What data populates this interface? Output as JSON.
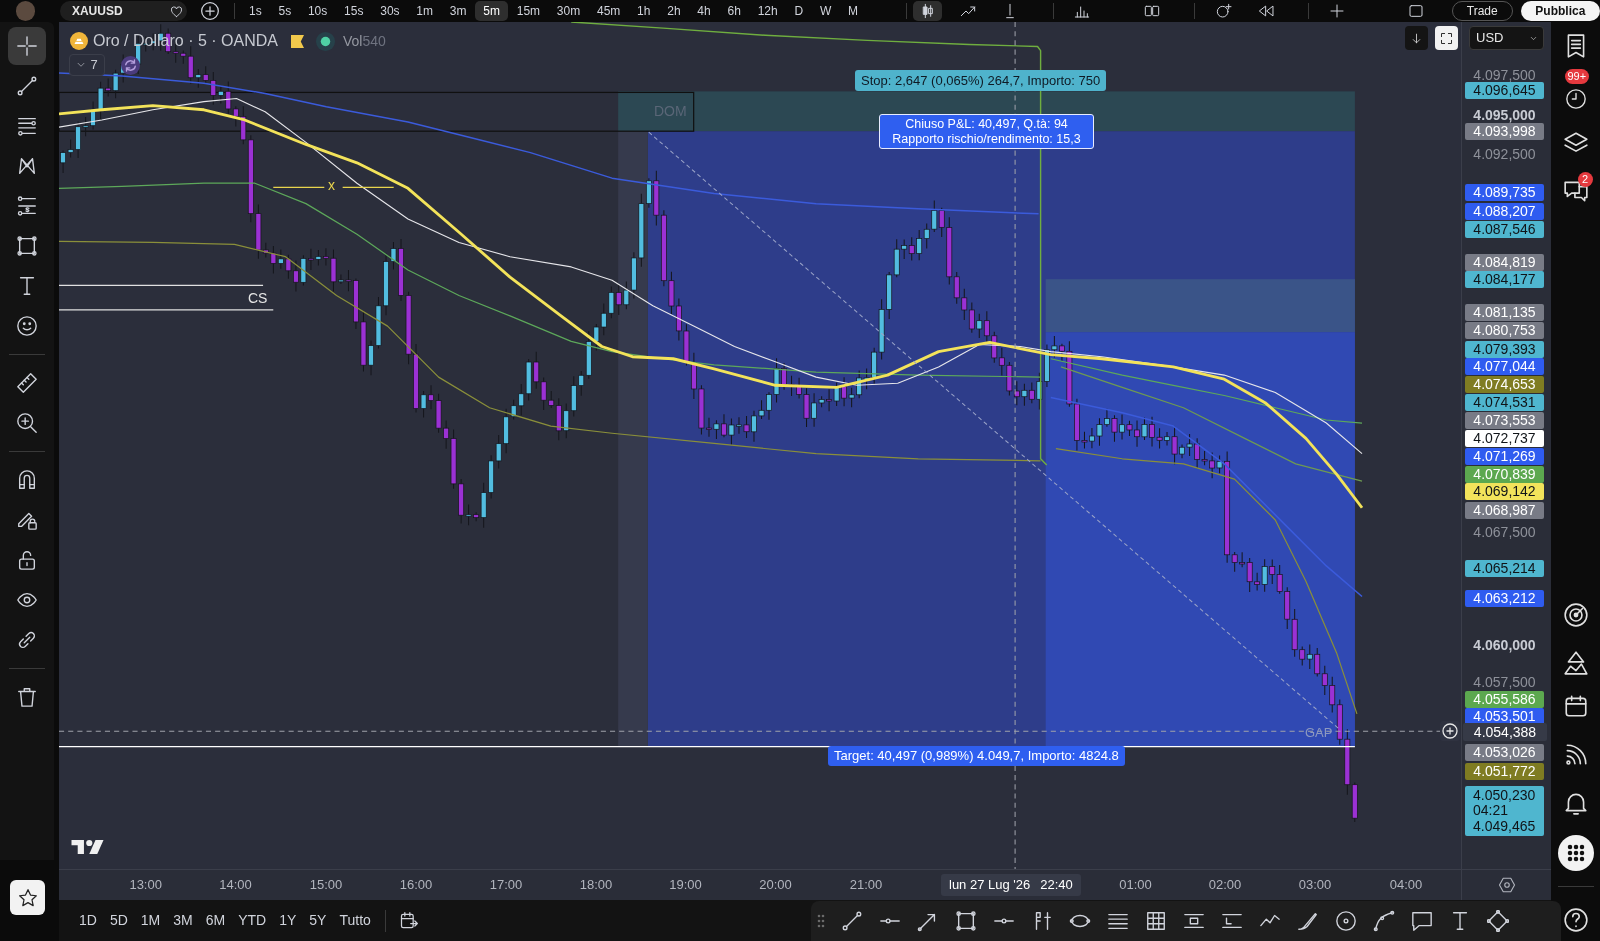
{
  "top_bar": {
    "symbol": "XAUUSD",
    "timeframes": [
      {
        "label": "1s",
        "selected": false
      },
      {
        "label": "5s",
        "selected": false
      },
      {
        "label": "10s",
        "selected": false
      },
      {
        "label": "15s",
        "selected": false
      },
      {
        "label": "30s",
        "selected": false
      },
      {
        "label": "1m",
        "selected": false
      },
      {
        "label": "3m",
        "selected": false
      },
      {
        "label": "5m",
        "selected": true
      },
      {
        "label": "15m",
        "selected": false
      },
      {
        "label": "30m",
        "selected": false
      },
      {
        "label": "45m",
        "selected": false
      },
      {
        "label": "1h",
        "selected": false
      },
      {
        "label": "2h",
        "selected": false
      },
      {
        "label": "4h",
        "selected": false
      },
      {
        "label": "6h",
        "selected": false
      },
      {
        "label": "12h",
        "selected": false
      },
      {
        "label": "D",
        "selected": false
      },
      {
        "label": "W",
        "selected": false
      },
      {
        "label": "M",
        "selected": false
      }
    ],
    "tools": [
      {
        "selected": true
      },
      {
        "selected": false
      },
      {
        "selected": false
      },
      {
        "selected": false
      },
      {
        "selected": false
      },
      {
        "selected": false
      },
      {
        "selected": false
      },
      {
        "selected": false
      },
      {
        "selected": false
      }
    ],
    "buttons": [
      {
        "label": "Trade",
        "kind": "outline"
      },
      {
        "label": "Pubblica",
        "kind": "solid"
      }
    ]
  },
  "left_toolbar": {
    "tools": [
      {
        "selected": true
      },
      {
        "selected": false
      },
      {
        "selected": false
      },
      {
        "selected": false
      },
      {
        "selected": false
      },
      {
        "selected": false
      },
      {
        "selected": false
      },
      {
        "selected": false
      },
      {
        "selected": false
      },
      {
        "selected": false
      },
      {
        "selected": false
      },
      {
        "selected": false
      },
      {
        "selected": false
      },
      {
        "selected": false
      },
      {
        "selected": false
      },
      {
        "selected": false
      }
    ]
  },
  "chart": {
    "title": "Oro / Dollaro · 5 · OANDA",
    "volume_label": "Vol",
    "volume_value": "540",
    "indicators_count": "7",
    "currency": "USD",
    "stop_label": "Stop: 2,647 (0,065%) 264,7, Importo: 750",
    "result_lines": [
      "Chiuso P&L: 40,497, Q.tà: 94",
      "Rapporto rischio/rendimento: 15,3"
    ],
    "target_label": "Target: 40,497 (0,989%) 4.049,7, Importo: 4824.8",
    "drawing_labels": [
      {
        "kind": "dom",
        "text": "DOM"
      },
      {
        "kind": "x",
        "text": "x"
      },
      {
        "kind": "cs",
        "text": "CS"
      },
      {
        "kind": "gap",
        "text": "GAP"
      }
    ]
  },
  "price_axis": {
    "labels": [
      {
        "text": "4.097,500",
        "kind": "tick"
      },
      {
        "text": "4.096,645",
        "kind": "tag",
        "color": "#4fb6cf"
      },
      {
        "text": "4.095,000",
        "kind": "major_tick"
      },
      {
        "text": "4.093,998",
        "kind": "tag",
        "color": "#787b86"
      },
      {
        "text": "4.092,500",
        "kind": "tick"
      },
      {
        "text": "4.089,735",
        "kind": "tag",
        "color": "#2f5cf0"
      },
      {
        "text": "4.088,207",
        "kind": "tag",
        "color": "#2f5cf0"
      },
      {
        "text": "4.087,546",
        "kind": "tag",
        "color": "#4fb6cf"
      },
      {
        "text": "4.084,819",
        "kind": "tag",
        "color": "#787b86"
      },
      {
        "text": "4.084,177",
        "kind": "tag",
        "color": "#4fb6cf"
      },
      {
        "text": "4.081,135",
        "kind": "tag",
        "color": "#787b86"
      },
      {
        "text": "4.080,753",
        "kind": "tag",
        "color": "#787b86"
      },
      {
        "text": "4.079,393",
        "kind": "tag",
        "color": "#4fb6cf"
      },
      {
        "text": "4.077,044",
        "kind": "tag",
        "color": "#2f5cf0"
      },
      {
        "text": "4.074,653",
        "kind": "tag",
        "color": "#7f7c22"
      },
      {
        "text": "4.074,531",
        "kind": "tag",
        "color": "#4fb6cf"
      },
      {
        "text": "4.073,553",
        "kind": "tag",
        "color": "#787b86"
      },
      {
        "text": "4.072,737",
        "kind": "tag",
        "color": "#ffffff"
      },
      {
        "text": "4.071,269",
        "kind": "tag",
        "color": "#2f5cf0"
      },
      {
        "text": "4.070,839",
        "kind": "tag",
        "color": "#5ca84f"
      },
      {
        "text": "4.069,142",
        "kind": "tag",
        "color": "#f2e35b"
      },
      {
        "text": "4.068,987",
        "kind": "tag",
        "color": "#787b86"
      },
      {
        "text": "4.067,500",
        "kind": "tick"
      },
      {
        "text": "4.065,214",
        "kind": "tag",
        "color": "#4fb6cf"
      },
      {
        "text": "4.063,212",
        "kind": "tag",
        "color": "#2f5cf0"
      },
      {
        "text": "4.060,000",
        "kind": "major_tick"
      },
      {
        "text": "4.057,500",
        "kind": "tick"
      },
      {
        "text": "4.055,586",
        "kind": "tag",
        "color": "#5ca84f"
      },
      {
        "text": "4.053,501",
        "kind": "tag",
        "color": "#2f5cf0"
      },
      {
        "text": "4.054,388",
        "kind": "crosshair"
      },
      {
        "text": "4.053,026",
        "kind": "tag",
        "color": "#787b86"
      },
      {
        "text": "4.051,772",
        "kind": "tag",
        "color": "#7f7c22"
      },
      {
        "kind": "current",
        "lines": [
          "4.050,230",
          "04:21",
          "4.049,465"
        ],
        "color": "#4fb6cf"
      }
    ]
  },
  "time_axis": {
    "labels": [
      "13:00",
      "14:00",
      "15:00",
      "16:00",
      "17:00",
      "18:00",
      "19:00",
      "20:00",
      "21:00",
      "01:00",
      "02:00",
      "03:00",
      "04:00"
    ],
    "crosshair_date": "lun 27 Lug '26",
    "crosshair_time": "22:40"
  },
  "bottom_bar": {
    "ranges": [
      "1D",
      "5D",
      "1M",
      "3M",
      "6M",
      "YTD",
      "1Y",
      "5Y",
      "Tutto"
    ]
  },
  "right_sidebar": {
    "alerts_badge": "99+",
    "chats_badge": "2"
  }
}
